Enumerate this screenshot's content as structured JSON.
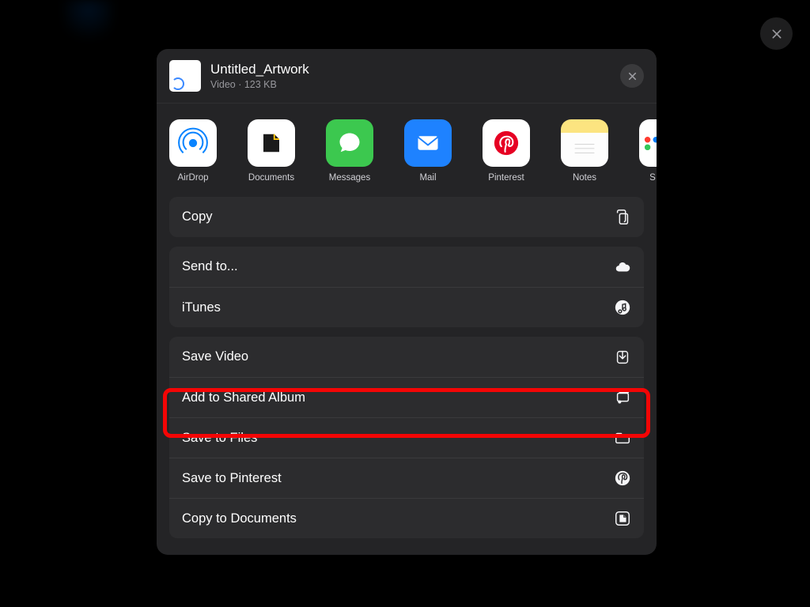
{
  "file": {
    "title": "Untitled_Artwork",
    "subtitle": "Video · 123 KB"
  },
  "apps": [
    {
      "id": "airdrop",
      "label": "AirDrop"
    },
    {
      "id": "documents",
      "label": "Documents"
    },
    {
      "id": "messages",
      "label": "Messages"
    },
    {
      "id": "mail",
      "label": "Mail"
    },
    {
      "id": "pinterest",
      "label": "Pinterest"
    },
    {
      "id": "notes",
      "label": "Notes"
    },
    {
      "id": "more",
      "label": "S"
    }
  ],
  "group1": [
    {
      "id": "copy",
      "label": "Copy",
      "icon": "copy-icon"
    }
  ],
  "group2": [
    {
      "id": "send-to",
      "label": "Send to...",
      "icon": "cloud-icon"
    },
    {
      "id": "itunes",
      "label": "iTunes",
      "icon": "music-note-circle-icon"
    }
  ],
  "group3": [
    {
      "id": "save-video",
      "label": "Save Video",
      "icon": "save-download-icon"
    },
    {
      "id": "add-shared-album",
      "label": "Add to Shared Album",
      "icon": "shared-album-icon"
    },
    {
      "id": "save-to-files",
      "label": "Save to Files",
      "icon": "folder-icon"
    },
    {
      "id": "save-to-pinterest",
      "label": "Save to Pinterest",
      "icon": "pinterest-circle-icon"
    },
    {
      "id": "copy-to-documents",
      "label": "Copy to Documents",
      "icon": "documents-app-icon"
    }
  ],
  "highlighted_action": "save-video"
}
